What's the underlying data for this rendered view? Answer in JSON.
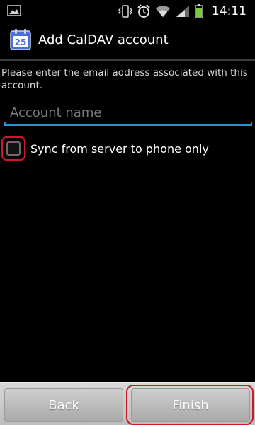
{
  "status_bar": {
    "time": "14:11",
    "icons": [
      "gallery-icon",
      "vibrate-icon",
      "alarm-icon",
      "wifi-icon",
      "signal-icon",
      "battery-icon"
    ],
    "battery_color": "#7ac943"
  },
  "header": {
    "app_icon": "calendar-icon",
    "calendar_day": "25",
    "title": "Add CalDAV account"
  },
  "form": {
    "prompt": "Please enter the email address associated with this account.",
    "account_name": {
      "value": "",
      "placeholder": "Account name"
    },
    "sync_option": {
      "label": "Sync from server to phone only",
      "checked": false
    }
  },
  "footer": {
    "back_label": "Back",
    "finish_label": "Finish"
  },
  "colors": {
    "accent": "#2a93c7",
    "highlight": "#d0182b",
    "calendar_icon": "#4a6fd8"
  }
}
